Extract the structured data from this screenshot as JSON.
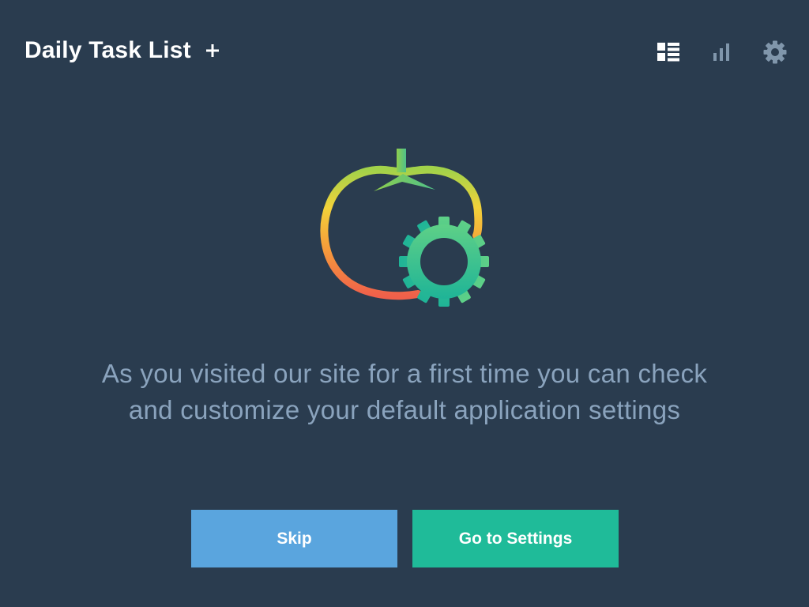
{
  "header": {
    "title": "Daily Task List",
    "add_icon": "plus-icon",
    "toolbar": [
      {
        "name": "list-view",
        "icon": "list-icon",
        "active": true
      },
      {
        "name": "statistics",
        "icon": "bar-chart-icon",
        "active": false
      },
      {
        "name": "settings",
        "icon": "gear-icon",
        "active": false
      }
    ]
  },
  "main": {
    "illustration_icon": "tomato-gear-icon",
    "message_lines": [
      "As you visited our site for a first time you can check",
      "and customize your default application settings"
    ]
  },
  "actions": {
    "skip_label": "Skip",
    "settings_label": "Go to Settings"
  },
  "colors": {
    "background": "#2a3c4f",
    "message_text": "#8aa3bd",
    "skip_button": "#5aa5de",
    "settings_button": "#1fbb99",
    "icon_inactive": "#8096ab",
    "icon_active": "#ffffff"
  }
}
